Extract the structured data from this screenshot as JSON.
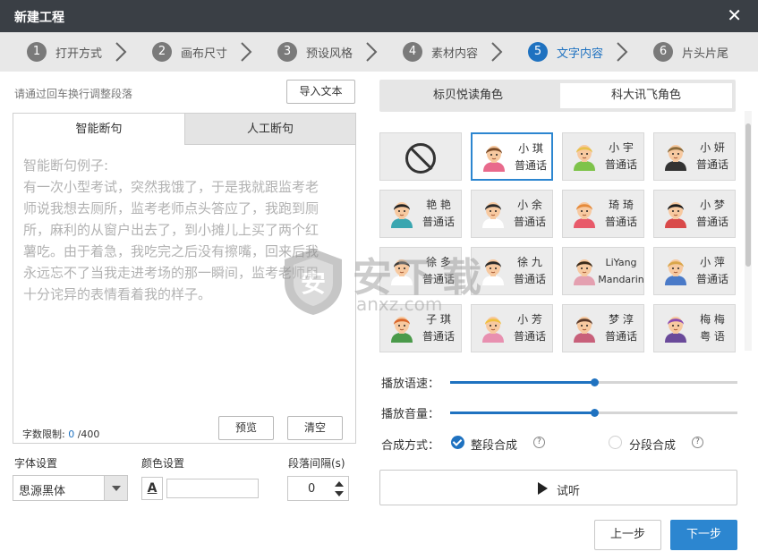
{
  "window": {
    "title": "新建工程",
    "close_glyph": "✕"
  },
  "steps": [
    {
      "num": "1",
      "label": "打开方式",
      "active": false
    },
    {
      "num": "2",
      "label": "画布尺寸",
      "active": false
    },
    {
      "num": "3",
      "label": "预设风格",
      "active": false
    },
    {
      "num": "4",
      "label": "素材内容",
      "active": false
    },
    {
      "num": "5",
      "label": "文字内容",
      "active": true
    },
    {
      "num": "6",
      "label": "片头片尾",
      "active": false
    }
  ],
  "left": {
    "hint": "请通过回车换行调整段落",
    "import_label": "导入文本",
    "tabs": {
      "smart": "智能断句",
      "manual": "人工断句"
    },
    "editor_placeholder": "智能断句例子:\n有一次小型考试，突然我饿了，于是我就跟监考老\n师说我想去厕所，监考老师点头答应了，我跑到厕\n所，麻利的从窗户出去了，到小摊儿上买了两个红\n薯吃。由于着急，我吃完之后没有擦嘴，回来后我\n永远忘不了当我走进考场的那一瞬间，监考老师用\n十分诧异的表情看着我的样子。",
    "char_limit": {
      "label": "字数限制: ",
      "current": "0",
      "max": " /400"
    },
    "preview_label": "预览",
    "clear_label": "清空",
    "font_label": "字体设置",
    "font_value": "思源黑体",
    "color_label": "颜色设置",
    "color_glyph": "A",
    "spacing_label": "段落间隔(s)",
    "spacing_value": "0"
  },
  "right": {
    "role_tabs": {
      "a": "标贝悦读角色",
      "b": "科大讯飞角色",
      "selected": "b"
    },
    "voices": [
      {
        "name": "",
        "lang": "",
        "type": "none"
      },
      {
        "name": "小 琪",
        "lang": "普通话",
        "selected": true,
        "avatar": "girl-brown"
      },
      {
        "name": "小 宇",
        "lang": "普通话",
        "avatar": "boy-blond"
      },
      {
        "name": "小 妍",
        "lang": "普通话",
        "avatar": "man-suit"
      },
      {
        "name": "艳 艳",
        "lang": "普通话",
        "avatar": "girl-bun"
      },
      {
        "name": "小 余",
        "lang": "普通话",
        "avatar": "boy-dark"
      },
      {
        "name": "琦 琦",
        "lang": "普通话",
        "avatar": "girl-orange"
      },
      {
        "name": "小 梦",
        "lang": "普通话",
        "avatar": "girl-black"
      },
      {
        "name": "徐 多",
        "lang": "普通话",
        "avatar": "man-glasses"
      },
      {
        "name": "徐 九",
        "lang": "普通话",
        "avatar": "man-shirt"
      },
      {
        "name": "LiYang",
        "lang": "Mandarin",
        "avatar": "woman-dark"
      },
      {
        "name": "小 萍",
        "lang": "普通话",
        "avatar": "woman-blond"
      },
      {
        "name": "子 琪",
        "lang": "普通话",
        "avatar": "boy-ginger"
      },
      {
        "name": "小 芳",
        "lang": "普通话",
        "avatar": "girl-blond"
      },
      {
        "name": "梦 淳",
        "lang": "普通话",
        "avatar": "girl-brunette"
      },
      {
        "name": "梅 梅",
        "lang": "粤 语",
        "avatar": "girl-purple"
      }
    ],
    "speed": {
      "label": "播放语速：",
      "value": 0.5
    },
    "volume": {
      "label": "播放音量：",
      "value": 0.5
    },
    "mode": {
      "label": "合成方式：",
      "opt1": "整段合成",
      "opt2": "分段合成",
      "selected": "opt1",
      "help_glyph": "?"
    },
    "listen_label": "试听"
  },
  "footer": {
    "prev": "上一步",
    "next": "下一步"
  },
  "watermark": {
    "big": "安下载",
    "small": "anxz.com"
  },
  "colors": {
    "accent": "#1f72c0",
    "titlebar": "#3a3f45",
    "steps_bg": "#e8e8e8"
  }
}
